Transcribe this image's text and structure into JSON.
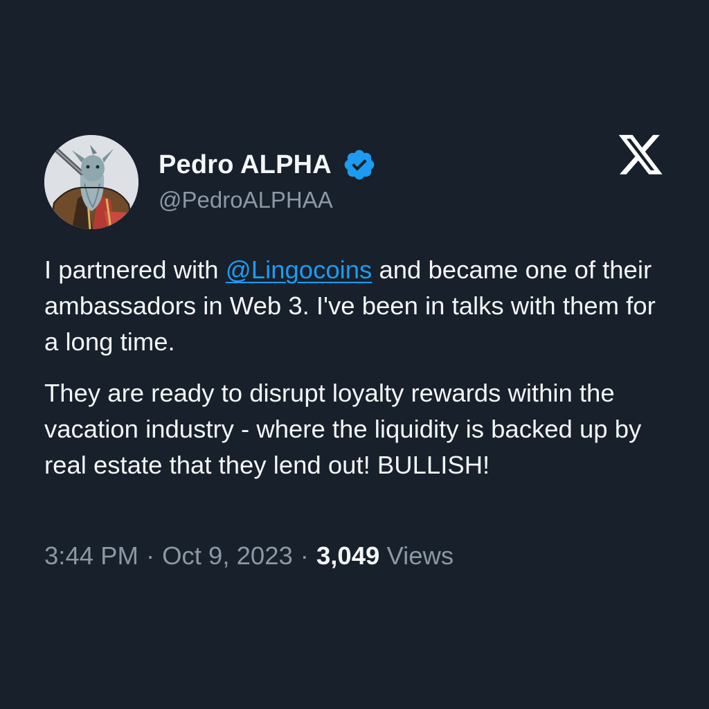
{
  "tweet": {
    "author": {
      "display_name": "Pedro ALPHA",
      "handle": "@PedroALPHAA",
      "verified": true,
      "avatar": "avatar-image"
    },
    "platform_icon": "x-logo-icon",
    "body": {
      "paragraph1_before": "I partnered with ",
      "mention": "@Lingocoins",
      "paragraph1_after": " and became one of their ambassadors in Web 3. I've been in talks with them for a long time.",
      "paragraph2": "They are ready to disrupt loyalty rewards within the vacation industry - where the liquidity is backed up by real estate that they lend out! BULLISH!"
    },
    "meta": {
      "time": "3:44 PM",
      "separator": "·",
      "date": "Oct 9, 2023",
      "views_count": "3,049",
      "views_label": "Views"
    }
  },
  "colors": {
    "background": "#17202b",
    "primary_text": "#f4f6f8",
    "secondary_text": "#8b98a5",
    "link": "#1d9bf0",
    "verified_badge": "#1d9bf0"
  }
}
